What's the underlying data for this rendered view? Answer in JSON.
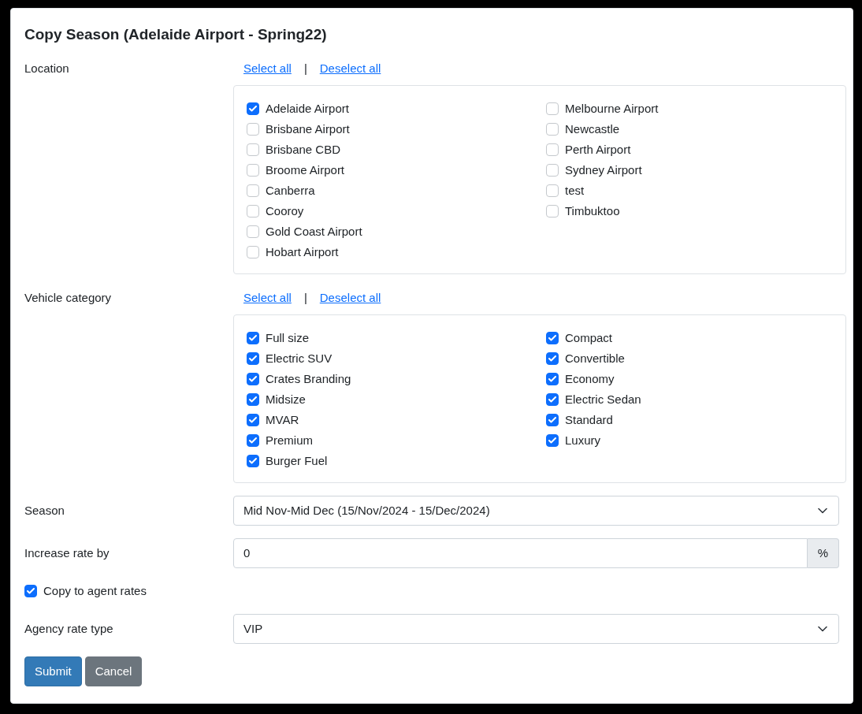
{
  "title": "Copy Season (Adelaide Airport - Spring22)",
  "groups": [
    {
      "label": "Location",
      "select_all": "Select all",
      "separator": "|",
      "deselect_all": "Deselect all",
      "columns": [
        [
          {
            "label": "Adelaide Airport",
            "checked": true
          },
          {
            "label": "Brisbane Airport",
            "checked": false
          },
          {
            "label": "Brisbane CBD",
            "checked": false
          },
          {
            "label": "Broome Airport",
            "checked": false
          },
          {
            "label": "Canberra",
            "checked": false
          },
          {
            "label": "Cooroy",
            "checked": false
          },
          {
            "label": "Gold Coast Airport",
            "checked": false
          },
          {
            "label": "Hobart Airport",
            "checked": false
          }
        ],
        [
          {
            "label": "Melbourne Airport",
            "checked": false
          },
          {
            "label": "Newcastle",
            "checked": false
          },
          {
            "label": "Perth Airport",
            "checked": false
          },
          {
            "label": "Sydney Airport",
            "checked": false
          },
          {
            "label": "test",
            "checked": false
          },
          {
            "label": "Timbuktoo",
            "checked": false
          }
        ]
      ]
    },
    {
      "label": "Vehicle category",
      "select_all": "Select all",
      "separator": "|",
      "deselect_all": "Deselect all",
      "columns": [
        [
          {
            "label": "Full size",
            "checked": true
          },
          {
            "label": "Electric SUV",
            "checked": true
          },
          {
            "label": "Crates Branding",
            "checked": true
          },
          {
            "label": "Midsize",
            "checked": true
          },
          {
            "label": "MVAR",
            "checked": true
          },
          {
            "label": "Premium",
            "checked": true
          },
          {
            "label": "Burger Fuel",
            "checked": true
          }
        ],
        [
          {
            "label": "Compact",
            "checked": true
          },
          {
            "label": "Convertible",
            "checked": true
          },
          {
            "label": "Economy",
            "checked": true
          },
          {
            "label": "Electric Sedan",
            "checked": true
          },
          {
            "label": "Standard",
            "checked": true
          },
          {
            "label": "Luxury",
            "checked": true
          }
        ]
      ]
    }
  ],
  "season": {
    "label": "Season",
    "value": "Mid Nov-Mid Dec (15/Nov/2024 - 15/Dec/2024)"
  },
  "increase": {
    "label": "Increase rate by",
    "value": "0",
    "suffix": "%"
  },
  "copy_agent": {
    "label": "Copy to agent rates",
    "checked": true
  },
  "agency": {
    "label": "Agency rate type",
    "value": "VIP"
  },
  "buttons": [
    {
      "label": "Submit",
      "kind": "primary"
    },
    {
      "label": "Cancel",
      "kind": "secondary"
    }
  ]
}
